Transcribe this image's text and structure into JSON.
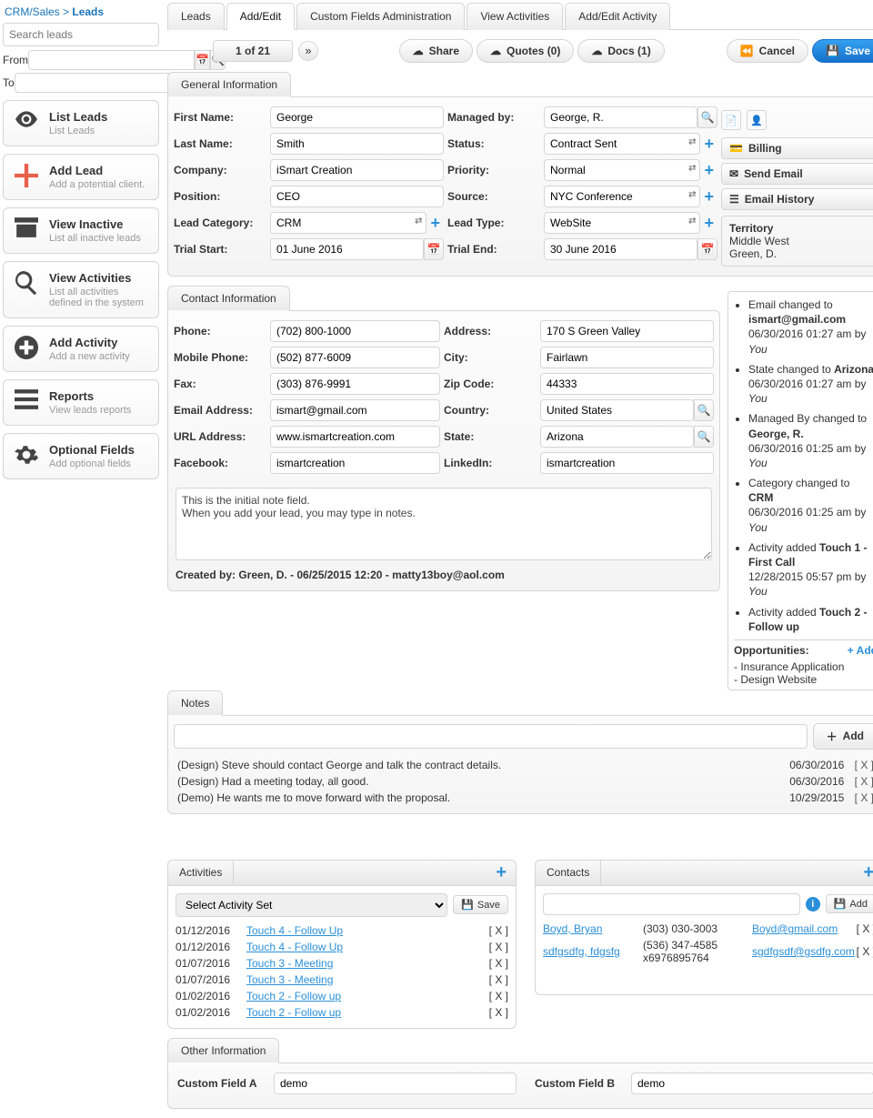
{
  "breadcrumb": {
    "path": "CRM/Sales > ",
    "current": "Leads"
  },
  "sidebar": {
    "search_placeholder": "Search leads",
    "from_label": "From",
    "to_label": "To",
    "items": [
      {
        "title": "List Leads",
        "sub": "List Leads"
      },
      {
        "title": "Add Lead",
        "sub": "Add a potential client."
      },
      {
        "title": "View Inactive",
        "sub": "List all inactive leads"
      },
      {
        "title": "View Activities",
        "sub": "List all activities defined in the system"
      },
      {
        "title": "Add Activity",
        "sub": "Add a new activity"
      },
      {
        "title": "Reports",
        "sub": "View leads reports"
      },
      {
        "title": "Optional Fields",
        "sub": "Add optional fields"
      }
    ]
  },
  "tabs": [
    "Leads",
    "Add/Edit",
    "Custom Fields Administration",
    "View Activities",
    "Add/Edit Activity"
  ],
  "active_tab": 1,
  "pager": {
    "text": "1 of 21",
    "next": "»"
  },
  "toolbar": {
    "share": "Share",
    "quotes": "Quotes (0)",
    "docs": "Docs (1)",
    "cancel": "Cancel",
    "save": "Save"
  },
  "section": {
    "general": "General Information",
    "contact": "Contact Information",
    "notes": "Notes",
    "activities": "Activities",
    "contacts": "Contacts",
    "other": "Other Information"
  },
  "general": {
    "first_name": {
      "label": "First Name:",
      "value": "George"
    },
    "last_name": {
      "label": "Last Name:",
      "value": "Smith"
    },
    "company": {
      "label": "Company:",
      "value": "iSmart Creation"
    },
    "position": {
      "label": "Position:",
      "value": "CEO"
    },
    "lead_category": {
      "label": "Lead Category:",
      "value": "CRM"
    },
    "trial_start": {
      "label": "Trial Start:",
      "value": "01 June 2016"
    },
    "managed_by": {
      "label": "Managed by:",
      "value": "George, R."
    },
    "status": {
      "label": "Status:",
      "value": "Contract Sent"
    },
    "priority": {
      "label": "Priority:",
      "value": "Normal"
    },
    "source": {
      "label": "Source:",
      "value": "NYC Conference"
    },
    "lead_type": {
      "label": "Lead Type:",
      "value": "WebSite"
    },
    "trial_end": {
      "label": "Trial End:",
      "value": "30 June 2016"
    }
  },
  "right_panel": {
    "billing": "Billing",
    "send_email": "Send Email",
    "email_history": "Email History",
    "territory_label": "Territory",
    "territory_value": "Middle West",
    "territory_owner": "Green, D.",
    "history": [
      {
        "pre": "Email changed to ",
        "bold": "ismart@gmail.com",
        "post": "",
        "meta": "06/30/2016 01:27 am by ",
        "by": "You"
      },
      {
        "pre": "State changed to ",
        "bold": "Arizona",
        "post": "",
        "meta": "06/30/2016 01:27 am by ",
        "by": "You"
      },
      {
        "pre": "Managed By changed to ",
        "bold": "George, R.",
        "post": "",
        "meta": "06/30/2016 01:25 am by ",
        "by": "You"
      },
      {
        "pre": "Category changed to ",
        "bold": "CRM",
        "post": "",
        "meta": "06/30/2016 01:25 am by ",
        "by": "You"
      },
      {
        "pre": "Activity added ",
        "bold": "Touch 1 - First Call",
        "post": "",
        "meta": "12/28/2015 05:57 pm by ",
        "by": "You"
      },
      {
        "pre": "Activity added ",
        "bold": "Touch 2 - Follow up",
        "post": "",
        "meta": "",
        "by": ""
      }
    ],
    "opps_label": "Opportunities:",
    "opps_add": "+ Add",
    "opps": [
      "- Insurance Application",
      "- Design Website"
    ]
  },
  "contact": {
    "phone": {
      "label": "Phone:",
      "value": "(702) 800-1000"
    },
    "mobile": {
      "label": "Mobile Phone:",
      "value": "(502) 877-6009"
    },
    "fax": {
      "label": "Fax:",
      "value": "(303) 876-9991"
    },
    "email": {
      "label": "Email Address:",
      "value": "ismart@gmail.com"
    },
    "url": {
      "label": "URL Address:",
      "value": "www.ismartcreation.com"
    },
    "facebook": {
      "label": "Facebook:",
      "value": "ismartcreation"
    },
    "address": {
      "label": "Address:",
      "value": "170 S Green Valley"
    },
    "city": {
      "label": "City:",
      "value": "Fairlawn"
    },
    "zip": {
      "label": "Zip Code:",
      "value": "44333"
    },
    "country": {
      "label": "Country:",
      "value": "United States"
    },
    "state": {
      "label": "State:",
      "value": "Arizona"
    },
    "linkedin": {
      "label": "LinkedIn:",
      "value": "ismartcreation"
    },
    "note_text": "This is the initial note field.\nWhen you add your lead, you may type in notes.",
    "created_by": "Created by: Green, D. - 06/25/2015 12:20 - matty13boy@aol.com"
  },
  "notes": {
    "add_btn": "Add",
    "items": [
      {
        "text": "(Design) Steve should contact George and talk the contract details.",
        "date": "06/30/2016",
        "del": "[ X ]"
      },
      {
        "text": "(Design) Had a meeting today, all good.",
        "date": "06/30/2016",
        "del": "[ X ]"
      },
      {
        "text": "(Demo) He wants me to move forward with the proposal.",
        "date": "10/29/2015",
        "del": "[ X ]"
      }
    ]
  },
  "activities": {
    "select_placeholder": "Select Activity Set",
    "save": "Save",
    "items": [
      {
        "date": "01/12/2016",
        "name": "Touch 4 - Follow Up",
        "del": "[ X ]"
      },
      {
        "date": "01/12/2016",
        "name": "Touch 4 - Follow Up",
        "del": "[ X ]"
      },
      {
        "date": "01/07/2016",
        "name": "Touch 3 - Meeting",
        "del": "[ X ]"
      },
      {
        "date": "01/07/2016",
        "name": "Touch 3 - Meeting",
        "del": "[ X ]"
      },
      {
        "date": "01/02/2016",
        "name": "Touch 2 - Follow up",
        "del": "[ X ]"
      },
      {
        "date": "01/02/2016",
        "name": "Touch 2 - Follow up",
        "del": "[ X ]"
      }
    ]
  },
  "contacts": {
    "add": "Add",
    "items": [
      {
        "name": "Boyd, Bryan",
        "phone": "(303) 030-3003",
        "email": "Boyd@gmail.com",
        "del": "[ X ]"
      },
      {
        "name": "sdfgsdfg, fdgsfg",
        "phone": "(536) 347-4585 x6976895764",
        "email": "sgdfgsdf@gsdfg.com",
        "del": "[ X ]"
      }
    ]
  },
  "other": {
    "a": {
      "label": "Custom Field A",
      "value": "demo"
    },
    "b": {
      "label": "Custom Field B",
      "value": "demo"
    }
  }
}
